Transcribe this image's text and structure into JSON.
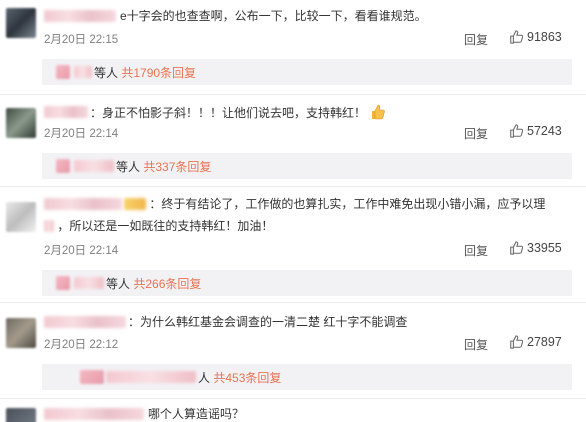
{
  "comments": [
    {
      "text": "e十字会的也查查啊，公布一下，比较一下，看看谁规范。",
      "time": "2月20日 22:15",
      "reply_label": "回复",
      "likes": "91863",
      "subreplies": {
        "prefix": "等人",
        "count_text": "共1790条回复"
      }
    },
    {
      "text": "：身正不怕影子斜！！！让他们说去吧，支持韩红！",
      "time": "2月20日 22:14",
      "reply_label": "回复",
      "likes": "57243",
      "subreplies": {
        "prefix": "等人",
        "count_text": "共337条回复"
      }
    },
    {
      "text_line1": "：终于有结论了，工作做的也算扎实，工作中难免出现小错小漏，应予以理",
      "text_line2": "，所以还是一如既往的支持韩红！加油！",
      "time": "2月20日 22:14",
      "reply_label": "回复",
      "likes": "33955",
      "subreplies": {
        "prefix": "等人",
        "count_text": "共266条回复"
      }
    },
    {
      "text": "：为什么韩红基金会调查的一清二楚 红十字不能调查",
      "time": "2月20日 22:12",
      "reply_label": "回复",
      "likes": "27897",
      "subreplies": {
        "prefix": "人",
        "count_text": "共453条回复"
      }
    },
    {
      "text": "哪个人算造谣吗？"
    }
  ],
  "colors": {
    "link": "#eb7350",
    "time": "#808080",
    "subbox_bg": "#f2f2f5"
  }
}
